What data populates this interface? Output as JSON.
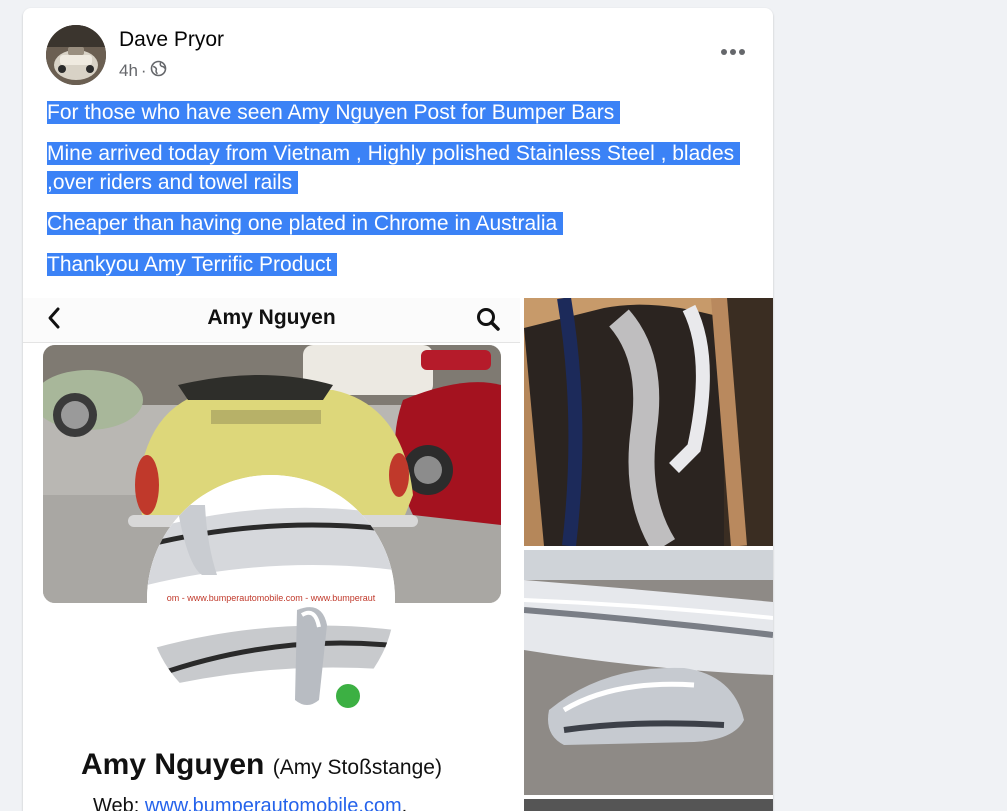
{
  "post": {
    "author": "Dave Pryor",
    "time": "4h",
    "separator": "·",
    "paragraphs": [
      "For those who have seen Amy Nguyen Post for Bumper Bars",
      "Mine arrived today from Vietnam , Highly polished Stainless Steel , blades ,over riders and towel rails",
      "Cheaper than having one plated in Chrome in Australia",
      "Thankyou Amy Terrific Product"
    ]
  },
  "media": {
    "screenshot": {
      "title": "Amy Nguyen",
      "watermark": "om - www.bumperautomobile.com - www.bumperaut",
      "profile_name": "Amy Nguyen",
      "profile_alias": "(Amy Stoßstange)",
      "web_label": "Web:",
      "web_link": "www.bumperautomobile.com",
      "web_trailing": ","
    }
  },
  "icons": {
    "more": "more-horizontal-icon",
    "privacy": "globe-icon",
    "back": "chevron-left-icon",
    "search": "search-icon"
  },
  "colors": {
    "highlight": "#3b82f6",
    "link": "#2563eb",
    "online": "#3cb043"
  }
}
